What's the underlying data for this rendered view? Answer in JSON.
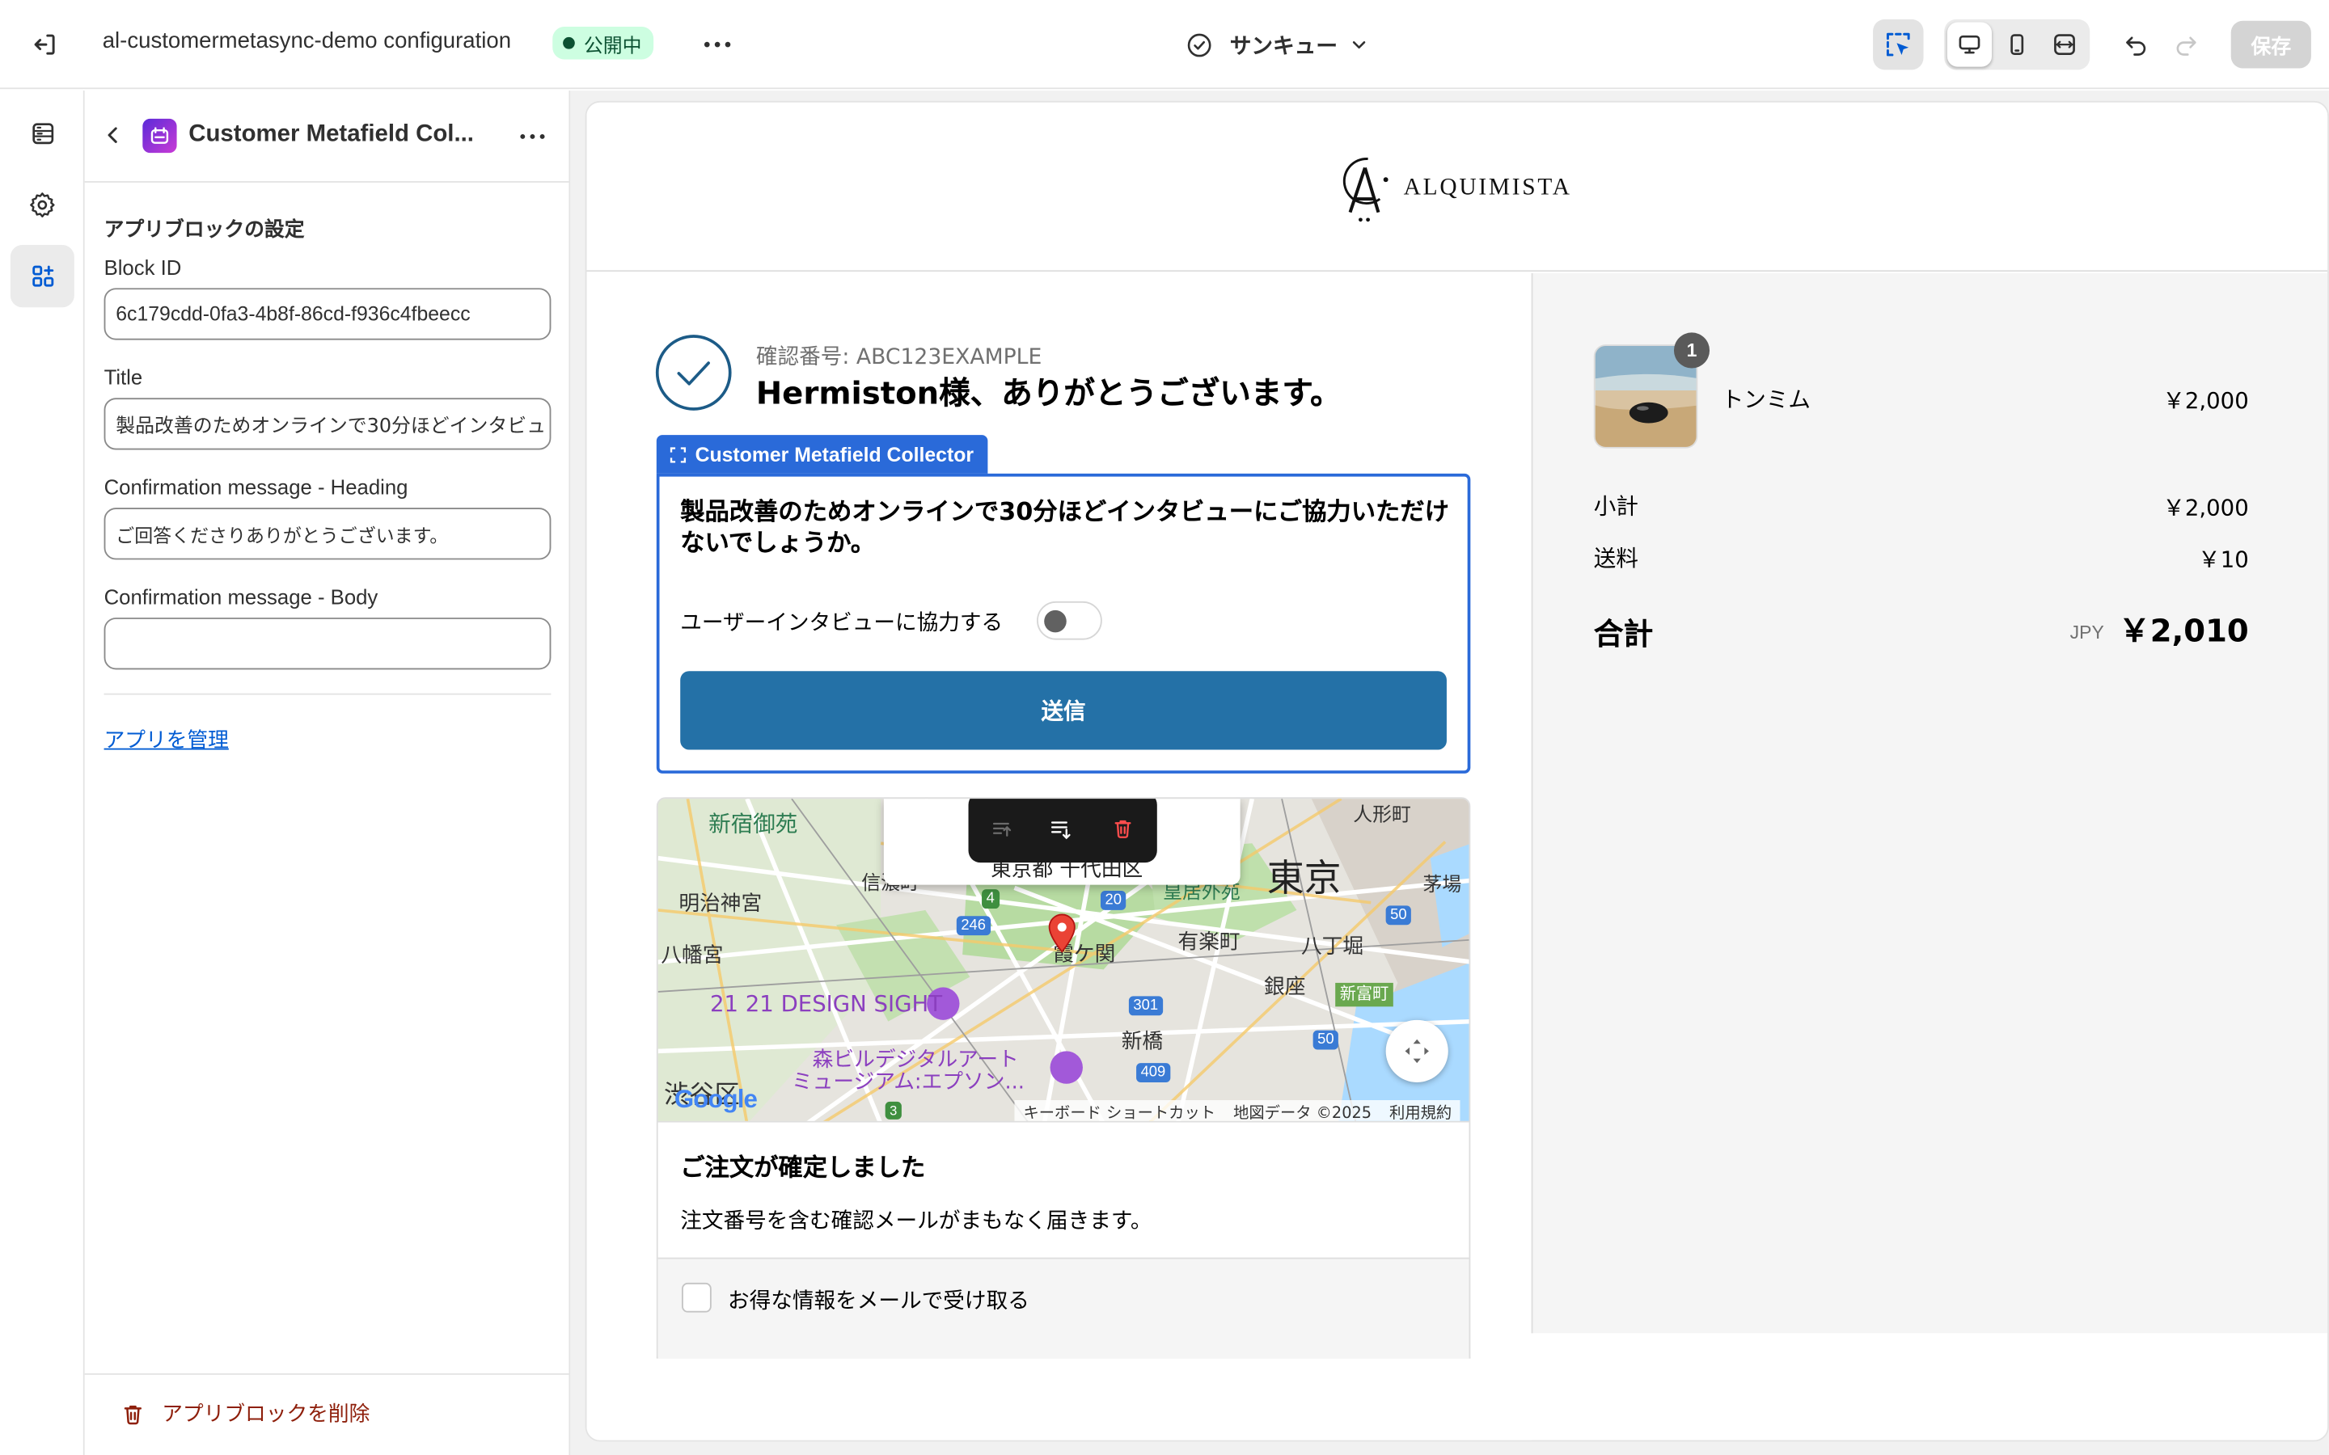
{
  "topbar": {
    "app_title": "al-customermetasync-demo configuration",
    "status_badge": "公開中",
    "page_selector": "サンキュー",
    "save_label": "保存"
  },
  "panel": {
    "block_title": "Customer Metafield Col...",
    "section_heading": "アプリブロックの設定",
    "fields": {
      "block_id": {
        "label": "Block ID",
        "value": "6c179cdd-0fa3-4b8f-86cd-f936c4fbeecc"
      },
      "title": {
        "label": "Title",
        "value": "製品改善のためオンラインで30分ほどインタビュ"
      },
      "confirm_heading": {
        "label": "Confirmation message - Heading",
        "value": "ご回答くださりありがとうございます。"
      },
      "confirm_body": {
        "label": "Confirmation message - Body",
        "value": ""
      }
    },
    "manage_app_link": "アプリを管理",
    "delete_block": "アプリブロックを削除"
  },
  "preview": {
    "brand": "ALQUIMISTA",
    "confirmation_number": "確認番号: ABC123EXAMPLE",
    "thank_you": "Hermiston様、ありがとうございます。",
    "block_tag": "Customer Metafield Collector",
    "survey": {
      "question": "製品改善のためオンラインで30分ほどインタビューにご協力いただけないでしょうか。",
      "toggle_label": "ユーザーインタビューに協力する",
      "toggle_on": false,
      "submit_label": "送信"
    },
    "map": {
      "address": "東京都 千代田区",
      "labels": {
        "shinjuku_gyoen": "新宿御苑",
        "meiji_jingu": "明治神宮",
        "hatagaya": "八幡宮",
        "design_sight": "21 21 DESIGN SIGHT",
        "mori": "森ビルデジタルアート",
        "mori2": "ミュージアム:エプソン...",
        "shibuya": "渋谷区",
        "tokyo": "東京",
        "ningyocho": "人形町",
        "kayabacho": "茅場",
        "yurakucho": "有楽町",
        "hatchobori": "八丁堀",
        "ginza": "銀座",
        "shintomicho": "新富町",
        "shimbashi": "新橋",
        "kasumigaseki": "霞ケ関",
        "shinanomachi": "信濃町",
        "kokyo": "皇居外苑",
        "google": "Google",
        "keyboard": "キーボード ショートカット",
        "mapdata": "地図データ ©2025",
        "terms": "利用規約",
        "r246": "246",
        "r20": "20",
        "r301": "301",
        "r409": "409",
        "r50a": "50",
        "r50b": "50",
        "r4": "4",
        "r3": "3"
      }
    },
    "order_confirmed": {
      "heading": "ご注文が確定しました",
      "body": "注文番号を含む確認メールがまもなく届きます。"
    },
    "newsletter_label": "お得な情報をメールで受け取る",
    "summary": {
      "item_name": "トンミム",
      "item_qty": "1",
      "item_price": "￥2,000",
      "subtotal_label": "小計",
      "subtotal": "￥2,000",
      "shipping_label": "送料",
      "shipping": "￥10",
      "total_label": "合計",
      "currency": "JPY",
      "total": "￥2,010"
    }
  },
  "colors": {
    "accent_blue": "#005bd3",
    "submit_blue": "#2471a7",
    "badge_green_bg": "#cdfee1",
    "badge_green_text": "#0c5132",
    "delete_red": "#8e1f0b",
    "check_blue": "#1c5b87"
  }
}
